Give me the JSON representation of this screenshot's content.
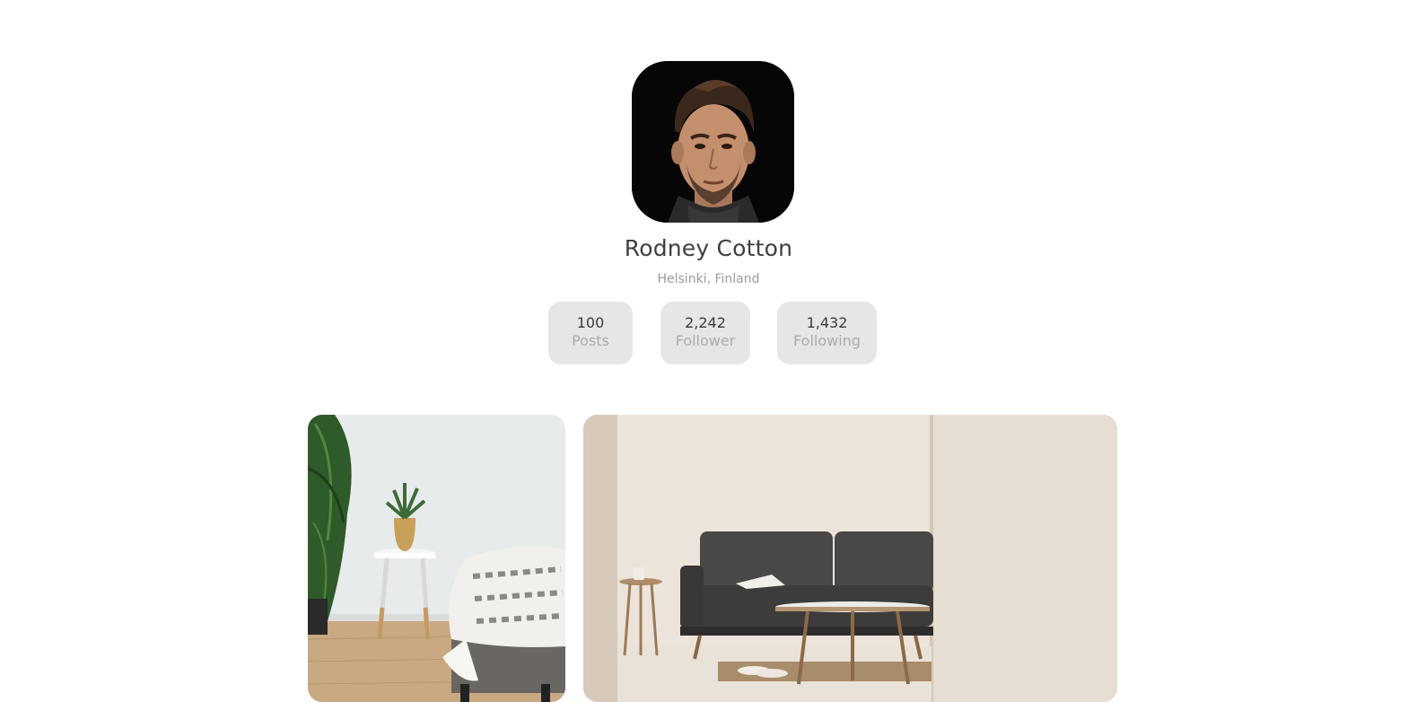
{
  "profile": {
    "name": "Rodney Cotton",
    "location": "Helsinki, Finland"
  },
  "stats": [
    {
      "value": "100",
      "label": "Posts"
    },
    {
      "value": "2,242",
      "label": "Follower"
    },
    {
      "value": "1,432",
      "label": "Following"
    }
  ],
  "gallery": [
    {
      "subject": "side table with potted plant beside bed"
    },
    {
      "subject": "dark grey sofa with wooden coffee table"
    }
  ],
  "colors": {
    "stat_background": "#e6e6e6",
    "name_text": "#3f3f3f",
    "muted_text": "#9d9d9d"
  }
}
